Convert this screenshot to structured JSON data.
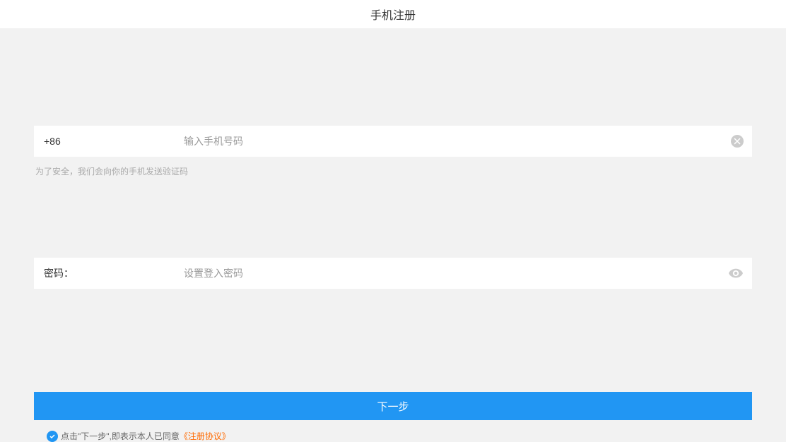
{
  "header": {
    "title": "手机注册"
  },
  "phone": {
    "prefix": "+86",
    "placeholder": "输入手机号码",
    "hint": "为了安全，我们会向你的手机发送验证码"
  },
  "password": {
    "label": "密码：",
    "placeholder": "设置登入密码"
  },
  "submit": {
    "label": "下一步"
  },
  "agreement": {
    "text": "点击\"下一步\",即表示本人已同意",
    "link": "《注册协议》"
  }
}
